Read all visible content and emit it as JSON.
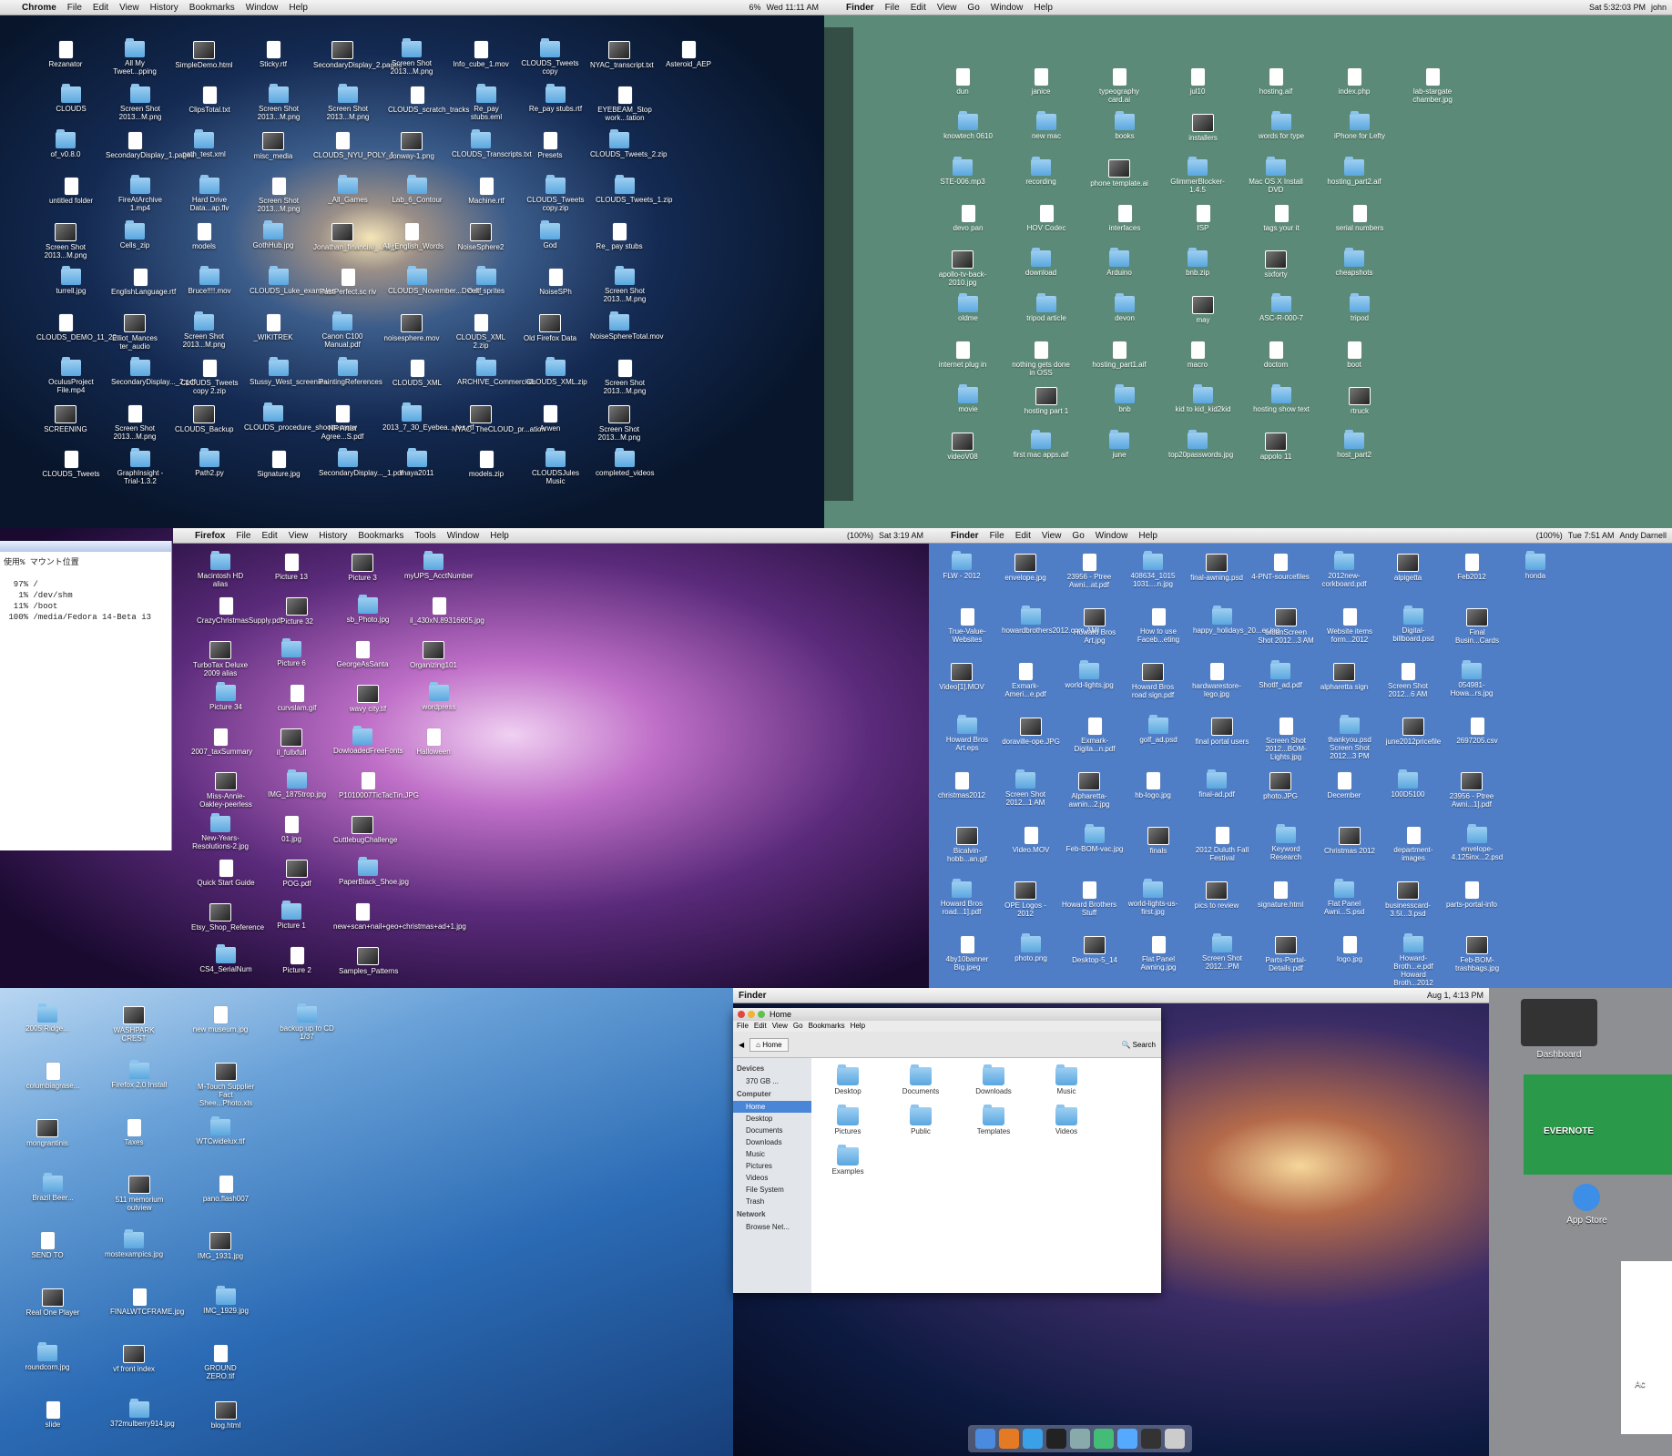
{
  "p1": {
    "menu": [
      "Chrome",
      "File",
      "Edit",
      "View",
      "History",
      "Bookmarks",
      "Window",
      "Help"
    ],
    "status": [
      "6%",
      "Wed 11:11 AM"
    ],
    "icons": [
      "Rezanator",
      "CLOUDS",
      "of_v0.8.0",
      "untitled folder",
      "Screen Shot 2013...M.png",
      "turrell.jpg",
      "CLOUDS_DEMO_11_20",
      "OculusProject File.mp4",
      "SCREENING",
      "CLOUDS_Tweets",
      "All My Tweet...pping",
      "Screen Shot 2013...M.png",
      "SecondaryDisplay_1.pages",
      "FireAtArchive 1.mp4",
      "Cells_zip",
      "EnglishLanguage.rtf",
      "Elliot_Mances ter_audio",
      "SecondaryDisplay..._2.pdf",
      "Screen Shot 2013...M.png",
      "GraphInsight -Trial-1.3.2",
      "SimpleDemo.html",
      "ClipsTotal.txt",
      "path_test.xml",
      "Hard Drive Data...ap.flv",
      "models",
      "Bruce!!!!.mov",
      "Screen Shot 2013...M.png",
      "CLOUDS_Tweets copy 2.zip",
      "CLOUDS_Backup",
      "Path2.py",
      "Sticky.rtf",
      "Screen Shot 2013...M.png",
      "misc_media",
      "Screen Shot 2013...M.png",
      "GothHub.jpg",
      "CLOUDS_Luke_examples",
      "_WIKITREK",
      "Stussy_West_screenies",
      "CLOUDS_procedure_shootter.mov",
      "Signature.jpg",
      "SecondaryDisplay_2.pages",
      "Screen Shot 2013...M.png",
      "CLOUDS_NYU_POLY_1",
      "_All_Games",
      "Jonathan_financial_...ents",
      "PastPerfect.sc riv",
      "Canon C100 Manual.pdf",
      "PaintingReferences",
      "NF Artist Agree...S.pdf",
      "SecondaryDisplay..._1.pdf",
      "Screen Shot 2013...M.png",
      "CLOUDS_scratch_tracks",
      "conway-1.png",
      "Lab_6_Contour",
      "All_English_Words",
      "CLOUDS_November...DO.rtf",
      "noisesphere.mov",
      "CLOUDS_XML",
      "2013_7_30_Eyebea....tes.rtf",
      "maya2011",
      "Info_cube_1.mov",
      "Re_pay stubs.eml",
      "CLOUDS_Transcripts.txt",
      "Machine.rtf",
      "NoiseSphere2",
      "cell_sprites",
      "CLOUDS_XML 2.zip",
      "ARCHIVE_Commercials",
      "NYAC_TheCLOUD_pr...ation",
      "models.zip",
      "CLOUDS_Tweets copy",
      "Re_pay stubs.rtf",
      "Presets",
      "CLOUDS_Tweets copy.zip",
      "God",
      "NoiseSPh",
      "Old Firefox Data",
      "CLOUDS_XML.zip",
      "Arwen",
      "CLOUDSJules Music",
      "NYAC_transcript.txt",
      "EYEBEAM_Stop work...tation",
      "CLOUDS_Tweets_2.zip",
      "CLOUDS_Tweets_1.zip",
      "Re_ pay stubs",
      "Screen Shot 2013...M.png",
      "NoiseSphereTotal.mov",
      "Screen Shot 2013...M.png",
      "Screen Shot 2013...M.png",
      "completed_videos",
      "Asteroid_AEP"
    ]
  },
  "p2": {
    "menu": [
      "Finder",
      "File",
      "Edit",
      "View",
      "Go",
      "Window",
      "Help"
    ],
    "status": [
      "Sat 5:32:03 PM",
      "john"
    ],
    "icons": [
      "dun",
      "knowtech 0610",
      "STE-006.mp3",
      "devo pan",
      "apollo-tv-back-2010.jpg",
      "oldme",
      "internet plug in",
      "movie",
      "videoV08",
      "janice",
      "new mac",
      "recording",
      "HOV Codec",
      "download",
      "tripod article",
      "nothing gets done in OSS",
      "hosting part 1",
      "first mac apps.aif",
      "typeography card.ai",
      "books",
      "phone template.ai",
      "interfaces",
      "Arduino",
      "devon",
      "hosting_part1.aif",
      "bnb",
      "june",
      "jul10",
      "installers",
      "GlimmerBlocker-1.4.5",
      "ISP",
      "bnb.zip",
      "may",
      "macro",
      "kid to kid_kid2kid",
      "top20passwords.jpg",
      "hosting.aif",
      "words for type",
      "Mac OS X Install DVD",
      "tags your it",
      "sixforty",
      "ASC-R-000-7",
      "doctom",
      "hosting show text",
      "appolo 11",
      "index.php",
      "iPhone for Lefty",
      "hosting_part2.aif",
      "serial numbers",
      "cheapshots",
      "tripod",
      "boot",
      "rtruck",
      "host_part2",
      "lab-stargate chamber.jpg"
    ]
  },
  "p3": {
    "menu": [
      "Firefox",
      "File",
      "Edit",
      "View",
      "History",
      "Bookmarks",
      "Tools",
      "Window",
      "Help"
    ],
    "status": [
      "(100%)",
      "Sat 3:19 AM"
    ],
    "terminal_lines": [
      "使用% マウント位置",
      "",
      "  97% /",
      "   1% /dev/shm",
      "  11% /boot",
      " 100% /media/Fedora 14-Beta i3"
    ],
    "icons": [
      "Macintosh HD alias",
      "CrazyChristmasSupply.pdf",
      "TurboTax Deluxe 2009 alias",
      "Picture 34",
      "2007_taxSummary",
      "Miss-Annie-Oakley-peerless",
      "New-Years-Resolutions-2.jpg",
      "Quick Start Guide",
      "Etsy_Shop_Reference",
      "CS4_SerialNum",
      "Picture 13",
      "Picture 32",
      "Picture 6",
      "curvslam.gif",
      "il_fullxfull",
      "IMG_1875trop.jpg",
      "01.jpg",
      "POG.pdf",
      "Picture 1",
      "Picture 2",
      "Picture 3",
      "sb_Photo.jpg",
      "GeorgeAsSanta",
      "wavy city.tif",
      "DowloadedFreeFonts",
      "P1010007TicTacTin.JPG",
      "CuttlebugChallenge",
      "PaperBlack_Shoe.jpg",
      "new+scan+nail+geo+christmas+ad+1.jpg",
      "Samples_Patterns",
      "myUPS_AcctNumber",
      "il_430xN.89316605.jpg",
      "Organizing101",
      "wordpress",
      "Halloween"
    ]
  },
  "p4": {
    "menu": [
      "Finder",
      "File",
      "Edit",
      "View",
      "Go",
      "Window",
      "Help"
    ],
    "status": [
      "(100%)",
      "Tue 7:51 AM",
      "Andy Darnell"
    ],
    "icons": [
      "FLW - 2012",
      "True-Value-Websites",
      "Video[1].MOV",
      "Howard Bros Art.eps",
      "christmas2012",
      "Bicalvin-hobb...an.gif",
      "Howard Bros road...1].pdf",
      "4by10banner Big.jpeg",
      "envelope.jpg",
      "howardbrothers2012.com.AMI",
      "Exmark-Ameri...e.pdf",
      "doraville-ope.JPG",
      "Screen Shot 2012...1 AM",
      "Video.MOV",
      "OPE Logos - 2012",
      "photo.png",
      "23956 - Ptree Awni...at.pdf",
      "Howard Bros Art.jpg",
      "world-lights.jpg",
      "Exmark-Digita...n.pdf",
      "Alpharetta-awnin...2.jpg",
      "Feb-BOM-vac.jpg",
      "Howard Brothers Stuff",
      "Desktop-5_14",
      "408634_1015 1031....n.jpg",
      "How to use Faceb...eting",
      "Howard Bros road sign.pdf",
      "golf_ad.psd",
      "hb-logo.jpg",
      "finals",
      "world-lights-us-first.jpg",
      "Flat Panel Awning.jpg",
      "final-awning.psd",
      "happy_holidays_20...er.jpg",
      "hardwarestore-lego.jpg",
      "final portal users",
      "final-ad.pdf",
      "2012 Duluth Fall Festival",
      "pics to review",
      "Screen Shot 2012...PM",
      "4-PNT-sourcefiles",
      "urbanScreen Shot 2012...3 AM",
      "ShotIf_ad.pdf",
      "Screen Shot 2012...BOM-Lights.jpg",
      "photo.JPG",
      "Keyword Research",
      "signature.html",
      "Parts-Portal-Details.pdf",
      "2012new-corkboard.pdf",
      "Website items form...2012",
      "alpharetta sign",
      "thankyou.psd Screen Shot 2012...3 PM",
      "December",
      "Christmas 2012",
      "Flat Panel Awni...S.psd",
      "logo.jpg",
      "alpigetta",
      "Digital-billboard.psd",
      "Screen Shot 2012...6 AM",
      "june2012pricefile",
      "100D5100",
      "department-images",
      "businesscard-3.5l...3.psd",
      "Howard-Broth...e.pdf Howard Broth...2012",
      "Feb2012",
      "Final Busin...Cards",
      "054981-Howa...rs.jpg",
      "2697205.csv",
      "23956 - Ptree Awni...1].pdf",
      "envelope-4.125inx...2.psd",
      "parts-portal-info",
      "Feb-BOM-trashbags.jpg",
      "honda"
    ]
  },
  "p5": {
    "icons": [
      "2005 Ridge...",
      "columbiagrase...",
      "mongrantinis",
      "Brazil Beer...",
      "SEND TO",
      "Real One Player",
      "roundcorn.jpg",
      "slide",
      "WASHPARK CREST",
      "Firefox 2.0 Install",
      "Taxes",
      "511 memorium outview",
      "mostexampics.jpg",
      "FINALWTCFRAME.jpg",
      "vf front index",
      "372mulberry914.jpg",
      "new museum.jpg",
      "M-Touch Supplier Fact Shee...Photo.xls",
      "WTCwidelux.tif",
      "pano.flash007",
      "IMG_1931.jpg",
      "IMC_1929.jpg",
      "GROUND ZERO.tif",
      "blog.html",
      "backup up to CD 1/37"
    ]
  },
  "p6": {
    "menu": [
      "Finder"
    ],
    "status": [
      "Aug 1, 4:13 PM"
    ],
    "window_title": "Home",
    "window_menu": [
      "File",
      "Edit",
      "View",
      "Go",
      "Bookmarks",
      "Help"
    ],
    "location": "Home",
    "search_placeholder": "Search",
    "sidebar": {
      "devices_header": "Devices",
      "device": "370 GB ...",
      "computer_header": "Computer",
      "computer_items": [
        "Home",
        "Desktop",
        "Documents",
        "Downloads",
        "Music",
        "Pictures",
        "Videos",
        "File System",
        "Trash"
      ],
      "network_header": "Network",
      "network_items": [
        "Browse Net..."
      ]
    },
    "files": [
      "Desktop",
      "Documents",
      "Downloads",
      "Music",
      "Pictures",
      "Public",
      "Templates",
      "Videos",
      "Examples"
    ]
  },
  "p7": {
    "tiles": [
      "Dashboard",
      "EVERNOTE",
      "App Store"
    ],
    "partial_label": "Ac"
  }
}
